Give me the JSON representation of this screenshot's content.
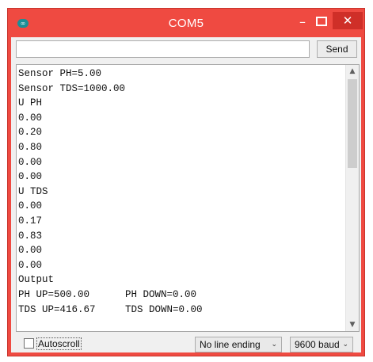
{
  "window": {
    "title": "COM5",
    "app_icon": "arduino-infinity-icon",
    "controls": {
      "minimize": "–",
      "close": "✕"
    }
  },
  "send_row": {
    "input_value": "",
    "send_label": "Send"
  },
  "serial_output": {
    "lines": [
      "Sensor PH=5.00",
      "Sensor TDS=1000.00",
      "U PH",
      "0.00",
      "0.20",
      "0.80",
      "0.00",
      "0.00",
      "U TDS",
      "0.00",
      "0.17",
      "0.83",
      "0.00",
      "0.00",
      "Output",
      "PH UP=500.00      PH DOWN=0.00",
      "TDS UP=416.67     TDS DOWN=0.00"
    ],
    "scroll_up_icon": "▲",
    "scroll_down_icon": "▼"
  },
  "bottom_bar": {
    "autoscroll_label": "Autoscroll",
    "autoscroll_checked": false,
    "line_ending": "No line ending",
    "baud_rate": "9600 baud",
    "dropdown_arrow": "⌄"
  },
  "colors": {
    "titlebar": "#ef4a41",
    "close_button": "#cf2f28",
    "app_icon": "#1b8f96"
  }
}
